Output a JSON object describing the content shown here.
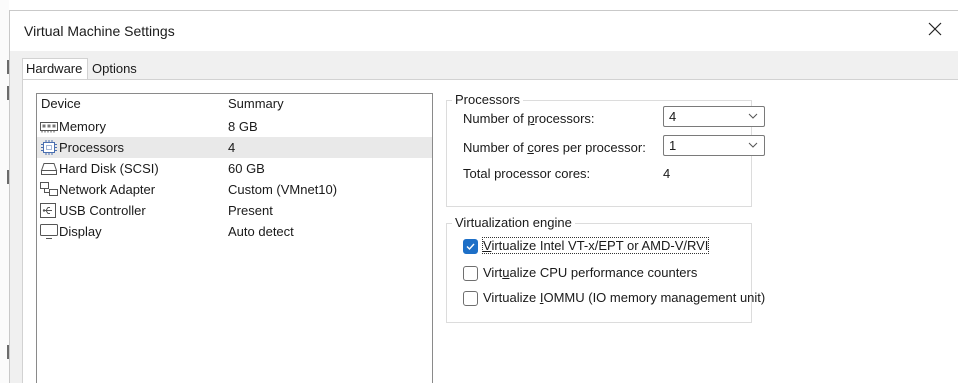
{
  "window": {
    "title": "Virtual Machine Settings"
  },
  "tabs": [
    {
      "label": "Hardware",
      "active": true
    },
    {
      "label": "Options",
      "active": false
    }
  ],
  "device_list": {
    "headers": {
      "device": "Device",
      "summary": "Summary"
    },
    "rows": [
      {
        "device": "Memory",
        "summary": "8 GB",
        "icon": "memory-icon"
      },
      {
        "device": "Processors",
        "summary": "4",
        "icon": "processor-icon",
        "selected": true
      },
      {
        "device": "Hard Disk (SCSI)",
        "summary": "60 GB",
        "icon": "hard-disk-icon"
      },
      {
        "device": "Network Adapter",
        "summary": "Custom (VMnet10)",
        "icon": "network-adapter-icon"
      },
      {
        "device": "USB Controller",
        "summary": "Present",
        "icon": "usb-icon"
      },
      {
        "device": "Display",
        "summary": "Auto detect",
        "icon": "display-icon"
      }
    ]
  },
  "processors": {
    "group_title": "Processors",
    "num_processors": {
      "label_pre": "Number of ",
      "label_u": "p",
      "label_post": "rocessors:",
      "value": "4"
    },
    "cores_per_processor": {
      "label_pre": "Number of ",
      "label_u": "c",
      "label_post": "ores per processor:",
      "value": "1"
    },
    "total_cores": {
      "label": "Total processor cores:",
      "value": "4"
    }
  },
  "virtualization": {
    "group_title": "Virtualization engine",
    "options": [
      {
        "pre": "",
        "u": "V",
        "post": "irtualize Intel VT-x/EPT or AMD-V/RVI",
        "checked": true
      },
      {
        "pre": "Virt",
        "u": "u",
        "post": "alize CPU performance counters",
        "checked": false
      },
      {
        "pre": "Virtualize ",
        "u": "I",
        "post": "OMMU (IO memory management unit)",
        "checked": false
      }
    ]
  },
  "colors": {
    "accent": "#1d6fc7",
    "selected_row": "#e9e9e9",
    "window_bg": "#f0f0f0"
  }
}
